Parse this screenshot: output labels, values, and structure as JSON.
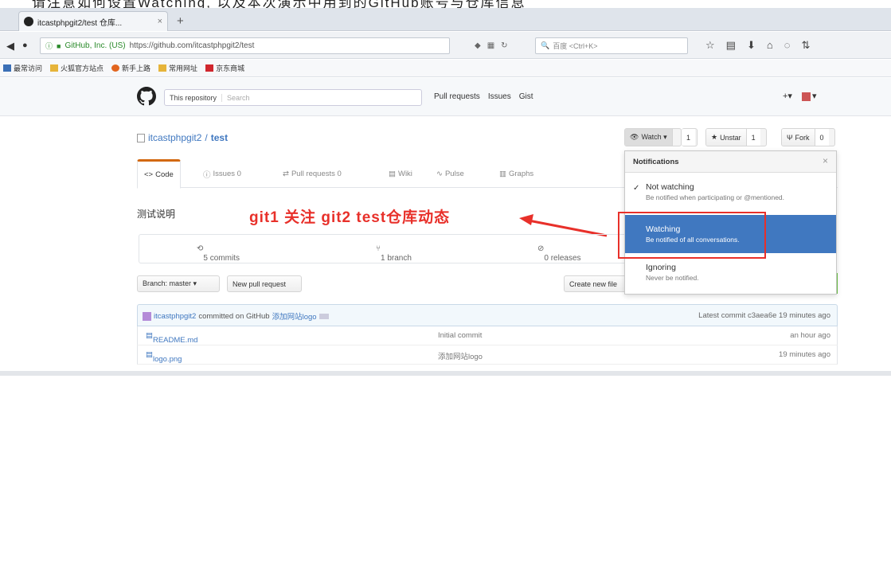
{
  "caption": "请注意如何设置Watching, 以及本次演示中用到的GitHub账号与仓库信息",
  "browser": {
    "tab_title": "itcastphpgit2/test 仓库...",
    "tab_close": "×",
    "new_tab": "+",
    "org_label": "GitHub, Inc. (US)",
    "url": "https://github.com/itcastphpgit2/test",
    "search_placeholder": "百度 <Ctrl+K>",
    "bookmarks": [
      "最常访问",
      "火狐官方站点",
      "新手上路",
      "常用网址",
      "京东商城"
    ],
    "bookmark_colors": [
      "#3b6fb6",
      "#e6b43a",
      "#e2651f",
      "#e6b43a",
      "#d0262d"
    ]
  },
  "github": {
    "search_scope": "This repository",
    "search_placeholder": "Search",
    "nav": [
      "Pull requests",
      "Issues",
      "Gist"
    ],
    "plus": "+▾",
    "avatar_caret": "▾"
  },
  "repo": {
    "owner": "itcastphpgit2",
    "sep": "/",
    "name": "test",
    "watch_label": "Watch ▾",
    "watch_count": "1",
    "star_label": "Unstar",
    "star_count": "1",
    "fork_label": "Fork",
    "fork_count": "0",
    "tabs": [
      "Code",
      "Issues 0",
      "Pull requests 0",
      "Wiki",
      "Pulse",
      "Graphs"
    ],
    "description": "测试说明",
    "commits": "5 commits",
    "branches": "1 branch",
    "releases": "0 releases",
    "branch_btn": "Branch: master ▾",
    "new_pr_btn": "New pull request",
    "create_file_btn": "Create new file",
    "latest_commit_author": "itcastphpgit2",
    "latest_commit_text": "committed on GitHub",
    "latest_commit_msg": "添加网站logo",
    "latest_commit_meta": "Latest commit c3aea6e 19 minutes ago",
    "files": [
      {
        "name": "README.md",
        "message": "Initial commit",
        "age": "an hour ago"
      },
      {
        "name": "logo.png",
        "message": "添加网站logo",
        "age": "19 minutes ago"
      }
    ]
  },
  "annotation": "git1 关注 git2 test仓库动态",
  "notifications": {
    "header": "Notifications",
    "close": "×",
    "items": [
      {
        "title": "Not watching",
        "subtitle": "Be notified when participating or @mentioned.",
        "checked": "✓"
      },
      {
        "title": "Watching",
        "subtitle": "Be notified of all conversations."
      },
      {
        "title": "Ignoring",
        "subtitle": "Never be notified."
      }
    ]
  },
  "colors": {
    "link": "#4078c0",
    "highlight": "#4078c0",
    "annotation_red": "#e8302a",
    "tab_active_orange": "#d26911"
  }
}
